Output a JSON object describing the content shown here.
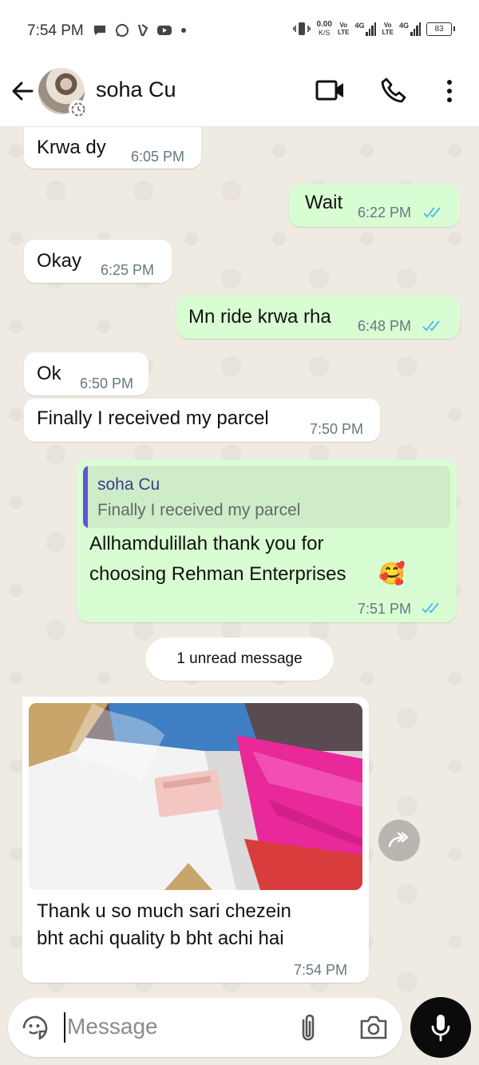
{
  "status_bar": {
    "time": "7:54 PM",
    "net_speed_value": "0.00",
    "net_speed_unit": "K/S",
    "sim1_label_top": "Vo",
    "sim1_label_bottom": "LTE",
    "sim1_network": "4G",
    "sim2_label_top": "Vo",
    "sim2_label_bottom": "LTE",
    "sim2_network": "4G",
    "battery": "83"
  },
  "header": {
    "contact_name": "soha Cu"
  },
  "messages": [
    {
      "direction": "in",
      "text": "Krwa dy",
      "time": "6:05 PM"
    },
    {
      "direction": "out",
      "text": "Wait",
      "time": "6:22 PM",
      "status": "read"
    },
    {
      "direction": "in",
      "text": "Okay",
      "time": "6:25 PM"
    },
    {
      "direction": "out",
      "text": "Mn ride krwa rha",
      "time": "6:48 PM",
      "status": "read"
    },
    {
      "direction": "in",
      "text": "Ok",
      "time": "6:50 PM"
    },
    {
      "direction": "in",
      "text": "Finally I received my parcel",
      "time": "7:50 PM"
    },
    {
      "direction": "out",
      "quote": {
        "author": "soha Cu",
        "text": "Finally I received my parcel"
      },
      "text_line1": "Allhamdulillah thank you for",
      "text_line2": "choosing Rehman Enterprises",
      "emoji": "🥰",
      "time": "7:51 PM",
      "status": "read"
    },
    {
      "direction": "in",
      "type": "image",
      "caption_line1": "Thank u so much sari chezein",
      "caption_line2": "bht achi quality b bht achi hai",
      "time": "7:54 PM"
    }
  ],
  "unread_divider": "1 unread message",
  "input": {
    "placeholder": "Message"
  },
  "colors": {
    "chat_background": "#efeae2",
    "incoming_bubble": "#ffffff",
    "outgoing_bubble": "#d9fdd3",
    "read_ticks": "#53bdeb",
    "quote_bar": "#5e55d6"
  }
}
